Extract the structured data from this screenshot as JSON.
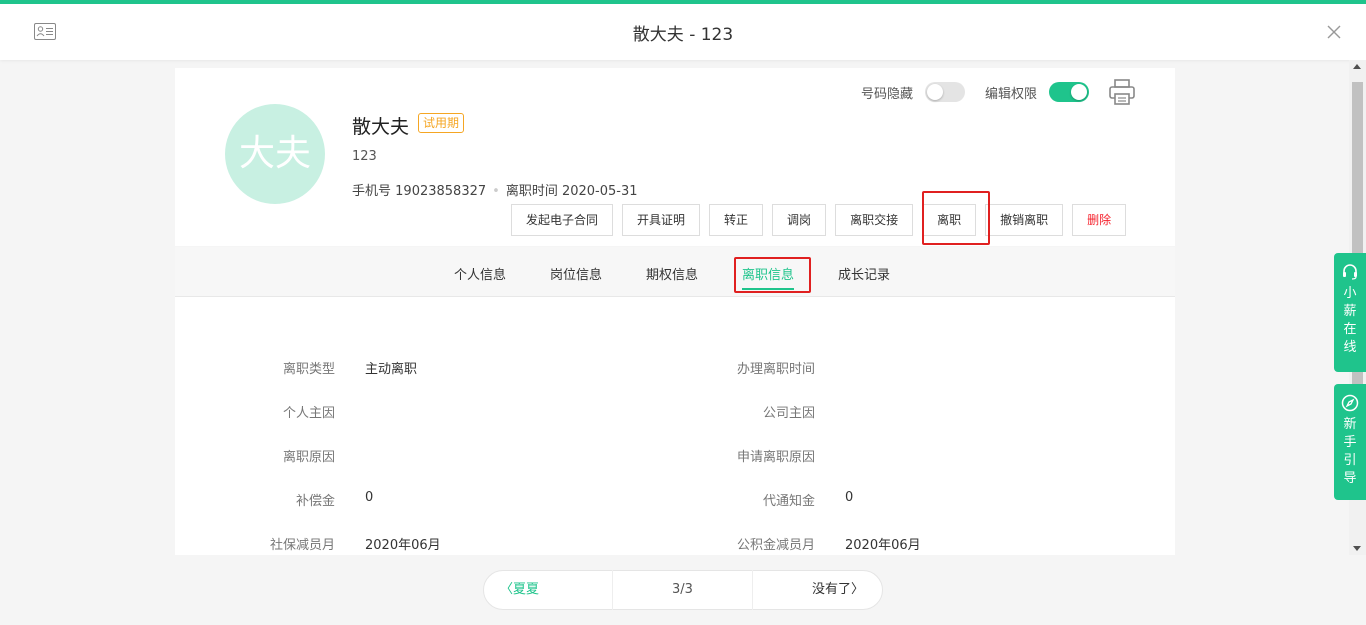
{
  "window": {
    "title": "散大夫 - 123"
  },
  "profile": {
    "avatar_text": "大夫",
    "name": "散大夫",
    "badge": "试用期",
    "code": "123",
    "phone_label": "手机号",
    "phone": "19023858327",
    "leave_label": "离职时间",
    "leave_date": "2020-05-31"
  },
  "toggles": {
    "hide_number": {
      "label": "号码隐藏",
      "state": "off"
    },
    "edit_permission": {
      "label": "编辑权限",
      "state": "on"
    }
  },
  "actions": [
    "发起电子合同",
    "开具证明",
    "转正",
    "调岗",
    "离职交接",
    "离职",
    "撤销离职",
    "删除"
  ],
  "tabs": [
    "个人信息",
    "岗位信息",
    "期权信息",
    "离职信息",
    "成长记录"
  ],
  "active_tab": "离职信息",
  "details": {
    "left": [
      {
        "label": "离职类型",
        "value": "主动离职"
      },
      {
        "label": "个人主因",
        "value": ""
      },
      {
        "label": "离职原因",
        "value": ""
      },
      {
        "label": "补偿金",
        "value": "0"
      },
      {
        "label": "社保减员月",
        "value": "2020年06月"
      }
    ],
    "right": [
      {
        "label": "办理离职时间",
        "value": ""
      },
      {
        "label": "公司主因",
        "value": ""
      },
      {
        "label": "申请离职原因",
        "value": ""
      },
      {
        "label": "代通知金",
        "value": "0"
      },
      {
        "label": "公积金减员月",
        "value": "2020年06月"
      }
    ]
  },
  "side": {
    "online": "小薪在线",
    "guide": "新手引导"
  },
  "pager": {
    "prev": "夏夏",
    "count": "3/3",
    "next": "没有了"
  },
  "colors": {
    "accent": "#1fc48c",
    "danger": "#f5222d",
    "highlight": "#e02020",
    "badge": "#f5a623"
  }
}
